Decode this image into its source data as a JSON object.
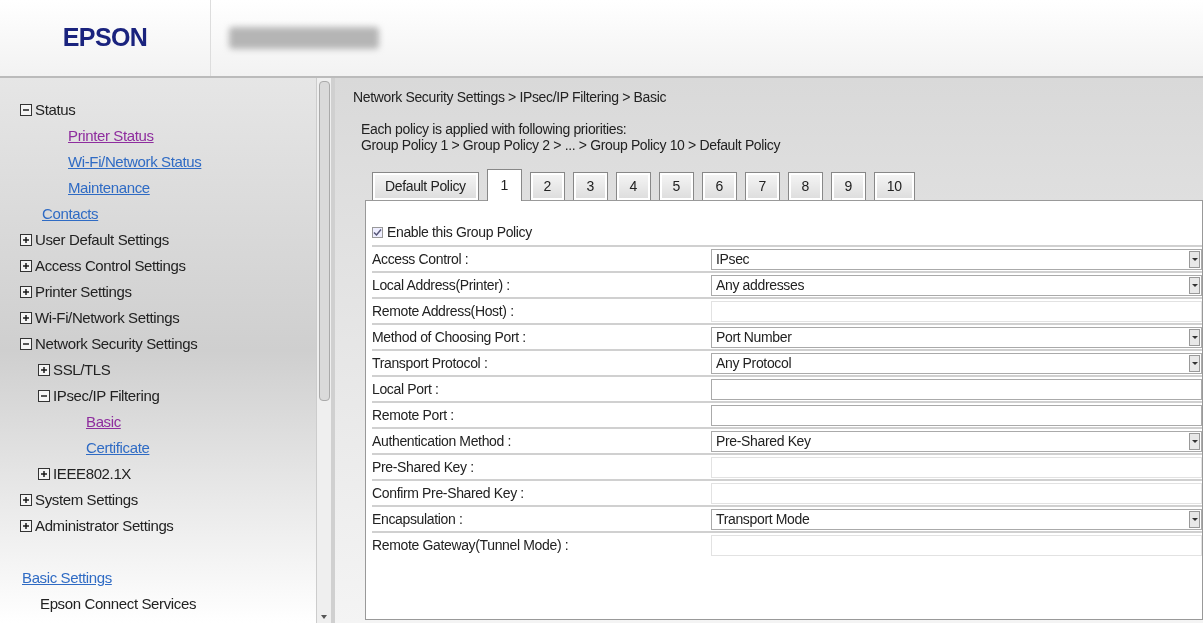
{
  "header": {
    "logo": "EPSON"
  },
  "sidebar": {
    "tree": [
      {
        "kind": "node",
        "label": "Status",
        "expanded": true,
        "children": [
          {
            "kind": "link",
            "label": "Printer Status",
            "visited": true
          },
          {
            "kind": "link",
            "label": "Wi-Fi/Network Status",
            "visited": false
          },
          {
            "kind": "link",
            "label": "Maintenance",
            "visited": false
          }
        ]
      },
      {
        "kind": "link",
        "label": "Contacts",
        "visited": false
      },
      {
        "kind": "node",
        "label": "User Default Settings",
        "expanded": false
      },
      {
        "kind": "node",
        "label": "Access Control Settings",
        "expanded": false
      },
      {
        "kind": "node",
        "label": "Printer Settings",
        "expanded": false
      },
      {
        "kind": "node",
        "label": "Wi-Fi/Network Settings",
        "expanded": false
      },
      {
        "kind": "node",
        "label": "Network Security Settings",
        "expanded": true,
        "children": [
          {
            "kind": "node",
            "label": "SSL/TLS",
            "expanded": false
          },
          {
            "kind": "node",
            "label": "IPsec/IP Filtering",
            "expanded": true,
            "children": [
              {
                "kind": "link",
                "label": "Basic",
                "visited": true
              },
              {
                "kind": "link",
                "label": "Certificate",
                "visited": false
              }
            ]
          },
          {
            "kind": "node",
            "label": "IEEE802.1X",
            "expanded": false
          }
        ]
      },
      {
        "kind": "node",
        "label": "System Settings",
        "expanded": false
      },
      {
        "kind": "node",
        "label": "Administrator Settings",
        "expanded": false
      }
    ],
    "footer": [
      {
        "kind": "link",
        "label": "Basic Settings",
        "visited": false,
        "children": [
          {
            "kind": "text",
            "label": "Epson Connect Services"
          }
        ]
      }
    ]
  },
  "main": {
    "breadcrumb": "Network Security Settings > IPsec/IP Filtering > Basic",
    "description": [
      "Each policy is applied with following priorities:",
      "Group Policy 1 > Group Policy 2 > ... > Group Policy 10 > Default Policy"
    ],
    "tabs": [
      {
        "label": "Default Policy",
        "selected": false
      },
      {
        "label": "1",
        "selected": true
      },
      {
        "label": "2",
        "selected": false
      },
      {
        "label": "3",
        "selected": false
      },
      {
        "label": "4",
        "selected": false
      },
      {
        "label": "5",
        "selected": false
      },
      {
        "label": "6",
        "selected": false
      },
      {
        "label": "7",
        "selected": false
      },
      {
        "label": "8",
        "selected": false
      },
      {
        "label": "9",
        "selected": false
      },
      {
        "label": "10",
        "selected": false
      }
    ],
    "enable": {
      "label": "Enable this Group Policy",
      "checked": true
    },
    "rows": [
      {
        "label": "Access Control :",
        "kind": "select",
        "value": "IPsec"
      },
      {
        "label": "Local Address(Printer) :",
        "kind": "select",
        "value": "Any addresses"
      },
      {
        "label": "Remote Address(Host) :",
        "kind": "text",
        "disabled": true
      },
      {
        "label": "Method of Choosing Port :",
        "kind": "select",
        "value": "Port Number"
      },
      {
        "label": "Transport Protocol :",
        "kind": "select",
        "value": "Any Protocol"
      },
      {
        "label": "Local Port :",
        "kind": "text",
        "disabled": false
      },
      {
        "label": "Remote Port :",
        "kind": "text",
        "disabled": false
      },
      {
        "label": "Authentication Method :",
        "kind": "select",
        "value": "Pre-Shared Key"
      },
      {
        "label": "Pre-Shared Key :",
        "kind": "text",
        "disabled": true
      },
      {
        "label": "Confirm Pre-Shared Key :",
        "kind": "text",
        "disabled": true
      },
      {
        "label": "Encapsulation :",
        "kind": "select",
        "value": "Transport Mode"
      },
      {
        "label": "Remote Gateway(Tunnel Mode) :",
        "kind": "text",
        "disabled": true
      }
    ]
  }
}
